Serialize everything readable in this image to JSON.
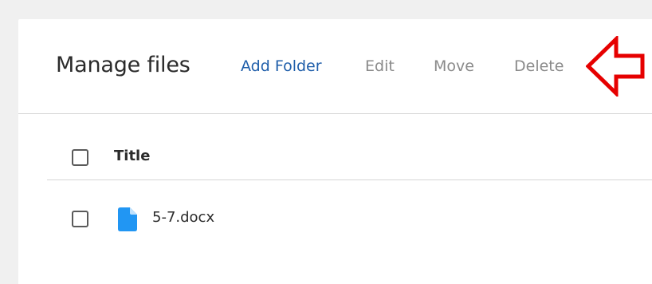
{
  "header": {
    "title": "Manage files",
    "actions": {
      "add_folder": "Add Folder",
      "edit": "Edit",
      "move": "Move",
      "delete": "Delete"
    }
  },
  "annotation": {
    "icon": "arrow-left-outline-icon",
    "color": "#e60000"
  },
  "table": {
    "columns": [
      "Title"
    ],
    "rows": [
      {
        "icon": "document-icon",
        "name": "5-7.docx"
      }
    ]
  },
  "colors": {
    "accent": "#1f5eaa",
    "disabled": "#8a8a8a",
    "file_icon": "#2196f3"
  }
}
